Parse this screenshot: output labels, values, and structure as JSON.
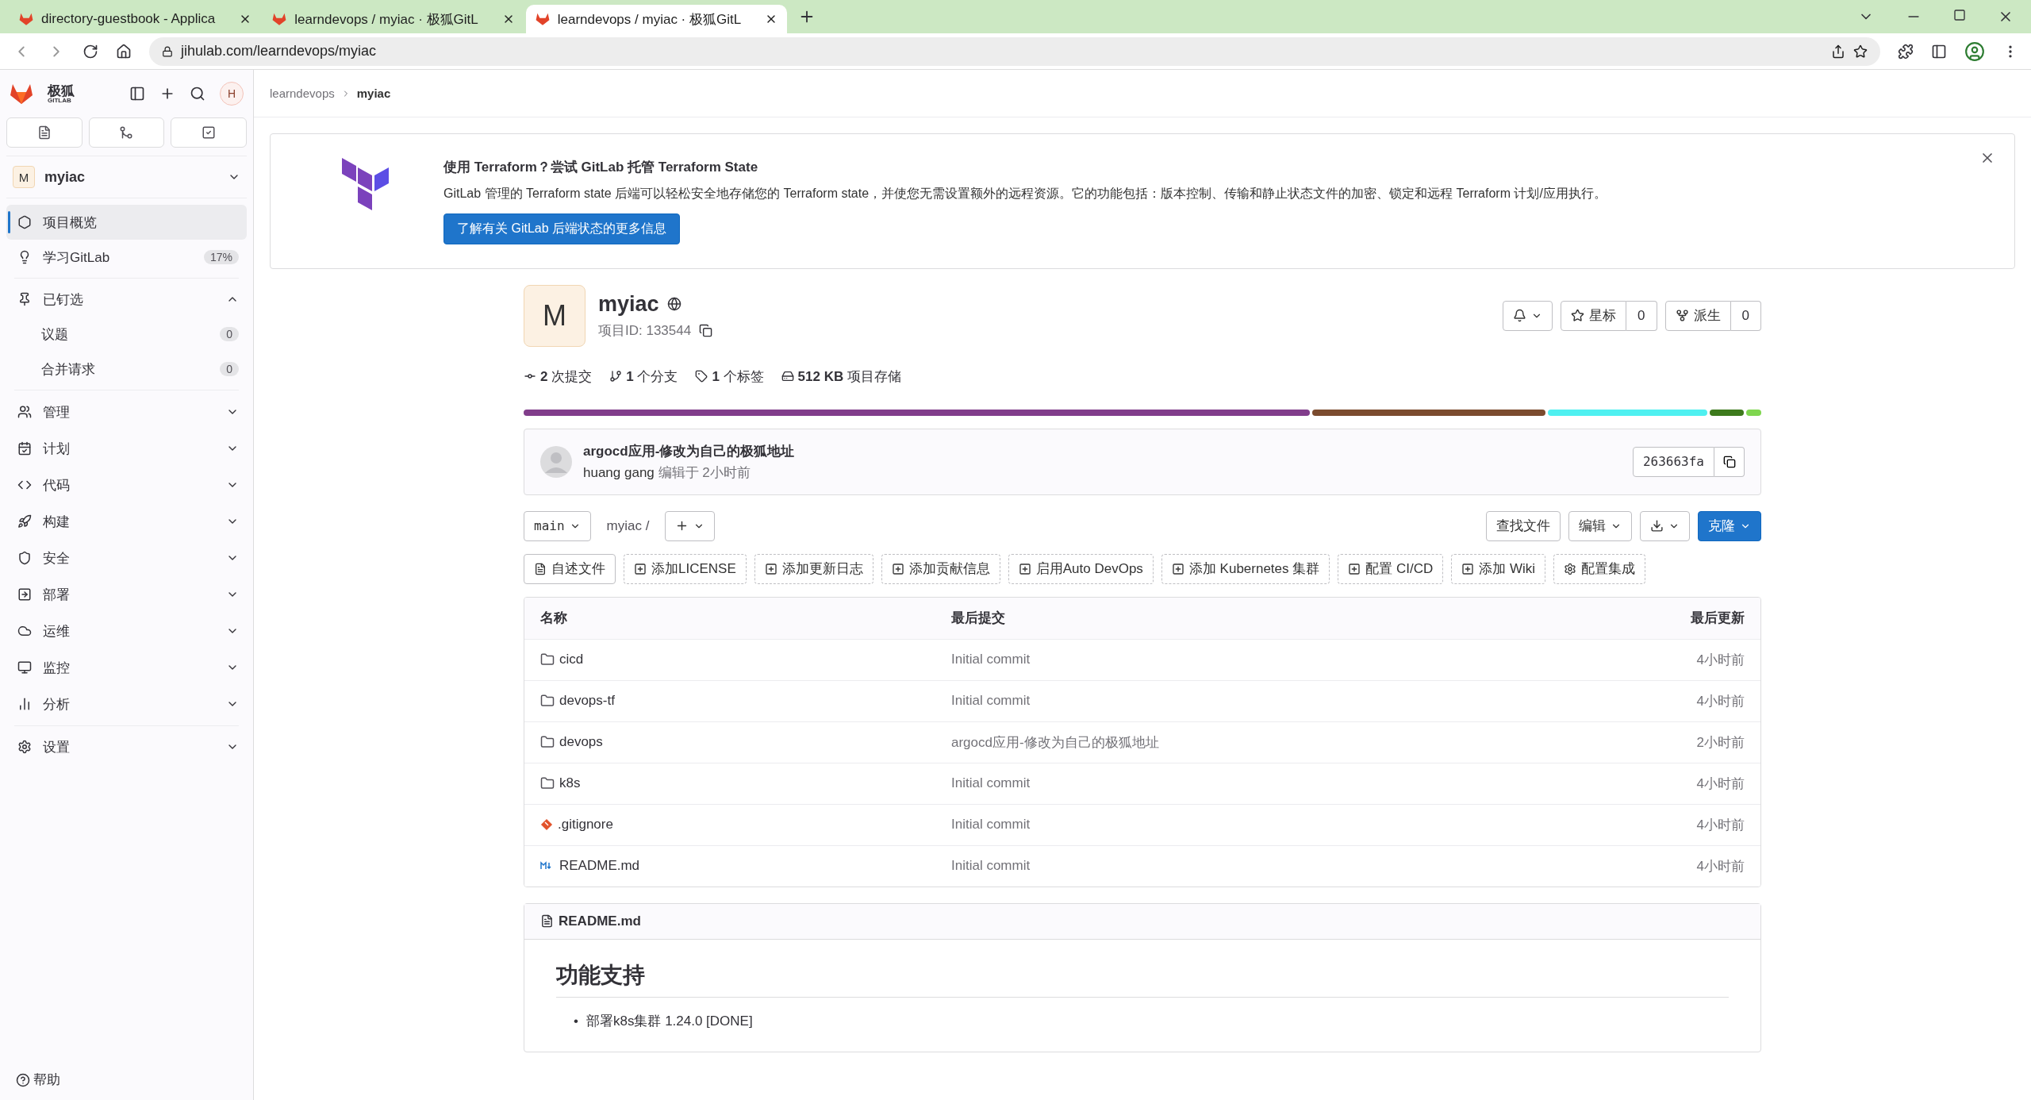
{
  "browser": {
    "tabs": [
      {
        "title": "directory-guestbook - Applica",
        "selected": false
      },
      {
        "title": "learndevops / myiac · 极狐GitL",
        "selected": false
      },
      {
        "title": "learndevops / myiac · 极狐GitL",
        "selected": true
      }
    ],
    "url": "jihulab.com/learndevops/myiac"
  },
  "sidebar": {
    "logo": "极狐",
    "logo_sub": "GITLAB",
    "user_initial": "H",
    "project": {
      "avatar": "M",
      "name": "myiac"
    },
    "items": [
      {
        "label": "项目概览",
        "selected": true
      },
      {
        "label": "学习GitLab",
        "badge": "17%",
        "selected": false
      }
    ],
    "pinned": {
      "label": "已钉选",
      "expanded": true,
      "children": [
        {
          "label": "议题",
          "count": "0"
        },
        {
          "label": "合并请求",
          "count": "0"
        }
      ]
    },
    "groups": [
      {
        "label": "管理",
        "expanded": false
      },
      {
        "label": "计划",
        "expanded": false
      },
      {
        "label": "代码",
        "expanded": false
      },
      {
        "label": "构建",
        "expanded": false
      },
      {
        "label": "安全",
        "expanded": false
      },
      {
        "label": "部署",
        "expanded": false
      },
      {
        "label": "运维",
        "expanded": false
      },
      {
        "label": "监控",
        "expanded": false
      },
      {
        "label": "分析",
        "expanded": false
      }
    ],
    "settings": {
      "label": "设置",
      "expanded": false
    },
    "help": "帮助"
  },
  "breadcrumb": [
    "learndevops",
    "myiac"
  ],
  "banner": {
    "title": "使用 Terraform？尝试 GitLab 托管 Terraform State",
    "text": "GitLab 管理的 Terraform state 后端可以轻松安全地存储您的 Terraform state，并使您无需设置额外的远程资源。它的功能包括：版本控制、传输和静止状态文件的加密、锁定和远程 Terraform 计划/应用执行。",
    "button": "了解有关 GitLab 后端状态的更多信息"
  },
  "project": {
    "avatar": "M",
    "name": "myiac",
    "id_label": "项目ID: 133544",
    "star_label": "星标",
    "star_count": "0",
    "fork_label": "派生",
    "fork_count": "0",
    "stats": [
      {
        "value": "2",
        "label": "次提交"
      },
      {
        "value": "1",
        "label": "个分支"
      },
      {
        "value": "1",
        "label": "个标签"
      },
      {
        "value": "512 KB",
        "label": "项目存储"
      }
    ],
    "languages": [
      {
        "color": "#813d8b"
      },
      {
        "color": "#7b4b2e"
      },
      {
        "color": "#4ff0f0"
      },
      {
        "color": "#3d7a1c"
      },
      {
        "color": "#7fd64f"
      }
    ]
  },
  "last_commit": {
    "title": "argocd应用-修改为自己的极狐地址",
    "author": "huang gang",
    "meta": "编辑于 2小时前",
    "sha": "263663fa"
  },
  "repo_bar": {
    "branch": "main",
    "path": "myiac",
    "separator": "/",
    "find": "查找文件",
    "edit": "编辑",
    "clone": "克隆"
  },
  "shortcuts": [
    {
      "label": "自述文件",
      "kind": "solid"
    },
    {
      "label": "添加LICENSE",
      "kind": "dashed"
    },
    {
      "label": "添加更新日志",
      "kind": "dashed"
    },
    {
      "label": "添加贡献信息",
      "kind": "dashed"
    },
    {
      "label": "启用Auto DevOps",
      "kind": "dashed"
    },
    {
      "label": "添加 Kubernetes 集群",
      "kind": "dashed"
    },
    {
      "label": "配置 CI/CD",
      "kind": "dashed"
    },
    {
      "label": "添加 Wiki",
      "kind": "dashed"
    },
    {
      "label": "配置集成",
      "kind": "settings"
    }
  ],
  "table": {
    "columns": [
      "名称",
      "最后提交",
      "最后更新"
    ],
    "rows": [
      {
        "name": "cicd",
        "kind": "folder",
        "commit": "Initial commit",
        "updated": "4小时前"
      },
      {
        "name": "devops-tf",
        "kind": "folder",
        "commit": "Initial commit",
        "updated": "4小时前"
      },
      {
        "name": "devops",
        "kind": "folder",
        "commit": "argocd应用-修改为自己的极狐地址",
        "updated": "2小时前"
      },
      {
        "name": "k8s",
        "kind": "folder",
        "commit": "Initial commit",
        "updated": "4小时前"
      },
      {
        "name": ".gitignore",
        "kind": "git",
        "commit": "Initial commit",
        "updated": "4小时前"
      },
      {
        "name": "README.md",
        "kind": "markdown",
        "commit": "Initial commit",
        "updated": "4小时前"
      }
    ]
  },
  "readme": {
    "file": "README.md",
    "heading": "功能支持",
    "items": [
      {
        "marker": "•",
        "text": "部署k8s集群 1.24.0 [DONE]"
      }
    ]
  }
}
